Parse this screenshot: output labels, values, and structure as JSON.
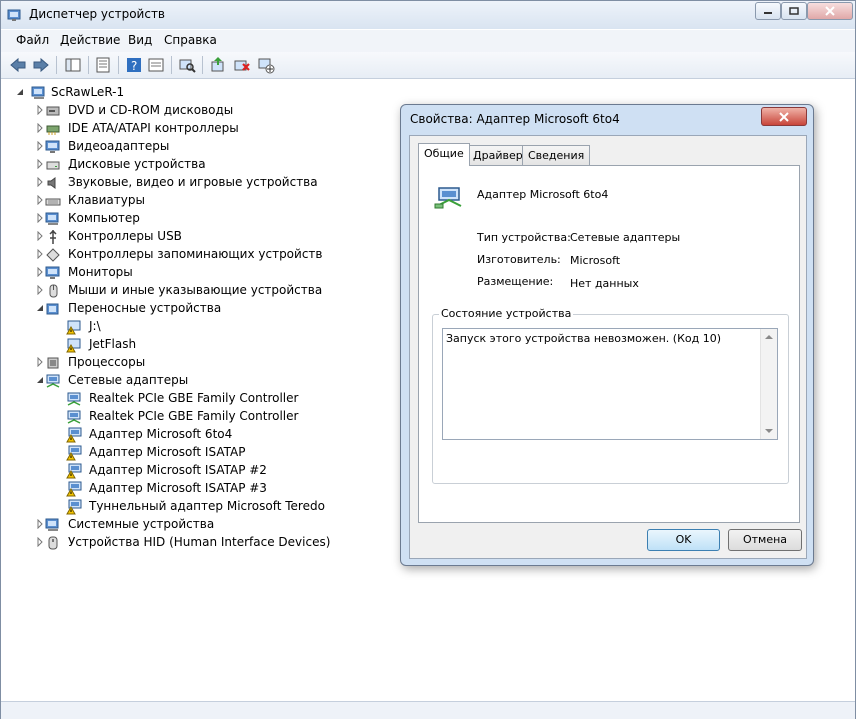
{
  "window": {
    "title": "Диспетчер устройств"
  },
  "menu": [
    "Файл",
    "Действие",
    "Вид",
    "Справка"
  ],
  "tree": {
    "root": "ScRawLeR-1",
    "items": [
      {
        "label": "DVD и CD-ROM дисководы",
        "icon": "dvd-drive-icon",
        "expanded": false,
        "level": 1
      },
      {
        "label": "IDE ATA/ATAPI контроллеры",
        "icon": "ide-controller-icon",
        "expanded": false,
        "level": 1
      },
      {
        "label": "Видеоадаптеры",
        "icon": "monitor-icon",
        "expanded": false,
        "level": 1
      },
      {
        "label": "Дисковые устройства",
        "icon": "disk-drive-icon",
        "expanded": false,
        "level": 1
      },
      {
        "label": "Звуковые, видео и игровые устройства",
        "icon": "speaker-icon",
        "expanded": false,
        "level": 1
      },
      {
        "label": "Клавиатуры",
        "icon": "keyboard-icon",
        "expanded": false,
        "level": 1
      },
      {
        "label": "Компьютер",
        "icon": "computer-icon",
        "expanded": false,
        "level": 1
      },
      {
        "label": "Контроллеры USB",
        "icon": "usb-icon",
        "expanded": false,
        "level": 1
      },
      {
        "label": "Контроллеры запоминающих устройств",
        "icon": "storage-controller-icon",
        "expanded": false,
        "level": 1
      },
      {
        "label": "Мониторы",
        "icon": "monitor-icon",
        "expanded": false,
        "level": 1
      },
      {
        "label": "Мыши и иные указывающие устройства",
        "icon": "mouse-icon",
        "expanded": false,
        "level": 1
      },
      {
        "label": "Переносные устройства",
        "icon": "portable-device-icon",
        "expanded": true,
        "level": 1
      },
      {
        "label": "J:\\",
        "icon": "warning-device-icon",
        "expanded": null,
        "level": 2
      },
      {
        "label": "JetFlash",
        "icon": "warning-device-icon",
        "expanded": null,
        "level": 2
      },
      {
        "label": "Процессоры",
        "icon": "processor-icon",
        "expanded": false,
        "level": 1
      },
      {
        "label": "Сетевые адаптеры",
        "icon": "network-adapter-icon",
        "expanded": true,
        "level": 1
      },
      {
        "label": "Realtek PCIe GBE Family Controller",
        "icon": "network-adapter-icon",
        "expanded": null,
        "level": 2
      },
      {
        "label": "Realtek PCIe GBE Family Controller",
        "icon": "network-adapter-icon",
        "expanded": null,
        "level": 2
      },
      {
        "label": "Адаптер Microsoft 6to4",
        "icon": "warning-network-icon",
        "expanded": null,
        "level": 2
      },
      {
        "label": "Адаптер Microsoft ISATAP",
        "icon": "warning-network-icon",
        "expanded": null,
        "level": 2
      },
      {
        "label": "Адаптер Microsoft ISATAP #2",
        "icon": "warning-network-icon",
        "expanded": null,
        "level": 2
      },
      {
        "label": "Адаптер Microsoft ISATAP #3",
        "icon": "warning-network-icon",
        "expanded": null,
        "level": 2
      },
      {
        "label": "Туннельный адаптер Microsoft Teredo",
        "icon": "warning-network-icon",
        "expanded": null,
        "level": 2
      },
      {
        "label": "Системные устройства",
        "icon": "computer-icon",
        "expanded": false,
        "level": 1
      },
      {
        "label": "Устройства HID (Human Interface Devices)",
        "icon": "hid-icon",
        "expanded": false,
        "level": 1
      }
    ]
  },
  "dialog": {
    "title": "Свойства: Адаптер Microsoft 6to4",
    "tabs": [
      "Общие",
      "Драйвер",
      "Сведения"
    ],
    "device_name": "Адаптер Microsoft 6to4",
    "properties": [
      {
        "label": "Тип устройства:",
        "value": "Сетевые адаптеры"
      },
      {
        "label": "Изготовитель:",
        "value": "Microsoft"
      },
      {
        "label": "Размещение:",
        "value": "Нет данных"
      }
    ],
    "status_group_label": "Состояние устройства",
    "status_text": "Запуск этого устройства невозможен. (Код 10)",
    "ok_label": "OK",
    "cancel_label": "Отмена"
  },
  "colors": {
    "accent": "#3c7fb1",
    "warning": "#f4c400"
  }
}
